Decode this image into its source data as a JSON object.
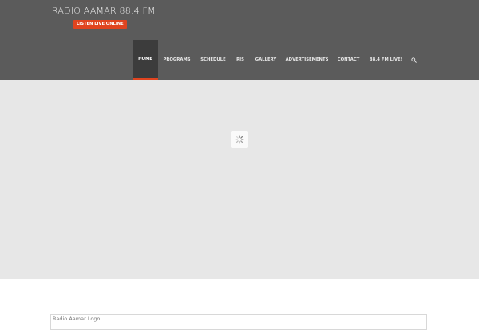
{
  "header": {
    "site_title": "RADIO AAMAR 88.4 FM",
    "listen_button": "LISTEN LIVE ONLINE",
    "nav": {
      "home": "HOME",
      "programs": "PROGRAMS",
      "schedule": "SCHEDULE",
      "rjs": "RJS",
      "gallery": "GALLERY",
      "advertisements": "ADVERTISEMENTS",
      "contact": "CONTACT",
      "live": "88.4 FM LIVE!"
    },
    "search_icon": "search-icon"
  },
  "slider": {
    "loading_icon": "spinner-icon"
  },
  "content": {
    "logo_alt": "Radio Aamar Logo"
  },
  "colors": {
    "header_bg": "#5b5b5b",
    "accent": "#e0441f",
    "active_nav_bg": "#3c3c3c",
    "slider_bg": "#e7e7e7"
  }
}
